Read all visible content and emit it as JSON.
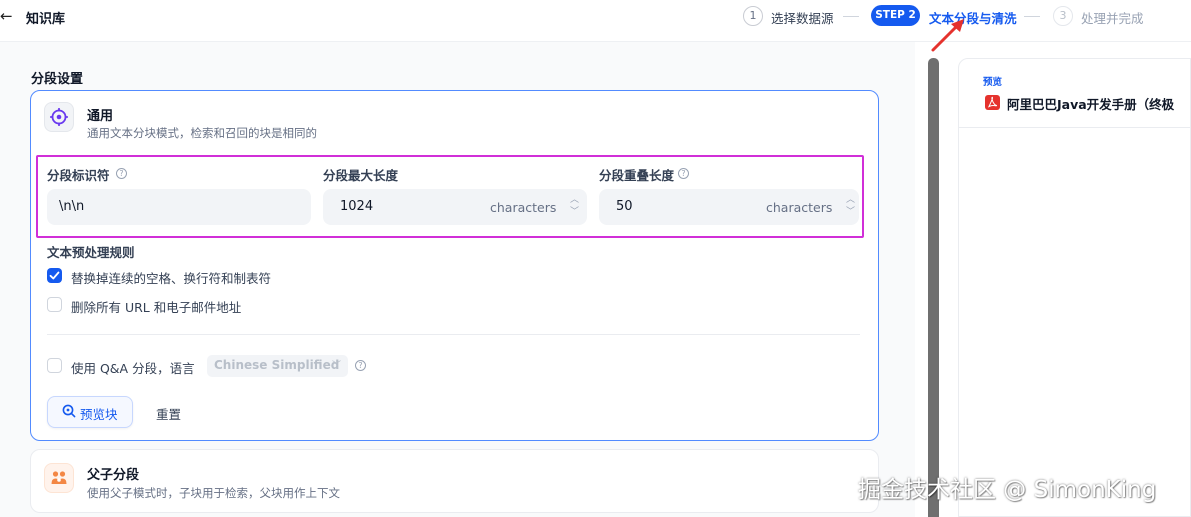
{
  "header": {
    "back_icon": "arrow-left-icon",
    "title": "知识库",
    "steps": [
      {
        "number": "1",
        "label": "选择数据源",
        "state": "done"
      },
      {
        "badge": "STEP 2",
        "label": "文本分段与清洗",
        "state": "active"
      },
      {
        "number": "3",
        "label": "处理并完成",
        "state": "pending"
      }
    ],
    "accent": "#155aef"
  },
  "segment_settings": {
    "title": "分段设置",
    "general": {
      "icon": "general-settings-icon",
      "title": "通用",
      "description": "通用文本分块模式，检索和召回的块是相同的",
      "fields": {
        "separator": {
          "label": "分段标识符",
          "value": "\\n\\n"
        },
        "max_length": {
          "label": "分段最大长度",
          "value": "1024",
          "unit": "characters"
        },
        "overlap": {
          "label": "分段重叠长度",
          "value": "50",
          "unit": "characters"
        }
      },
      "rules": {
        "title": "文本预处理规则",
        "items": [
          {
            "label": "替换掉连续的空格、换行符和制表符",
            "checked": true
          },
          {
            "label": "删除所有 URL 和电子邮件地址",
            "checked": false
          }
        ]
      },
      "qa": {
        "label": "使用 Q&A 分段，语言",
        "checked": false,
        "language": "Chinese Simplified"
      },
      "buttons": {
        "preview": "预览块",
        "reset": "重置"
      }
    },
    "parent_child": {
      "icon": "parent-child-icon",
      "title": "父子分段",
      "description": "使用父子模式时，子块用于检索，父块用作上下文"
    }
  },
  "preview_panel": {
    "label": "预览",
    "doc_icon": "pdf-icon",
    "doc_title": "阿里巴巴Java开发手册（终极"
  },
  "highlight_color": "#d12fd8",
  "watermark": "掘金技术社区 @ SimonKing"
}
